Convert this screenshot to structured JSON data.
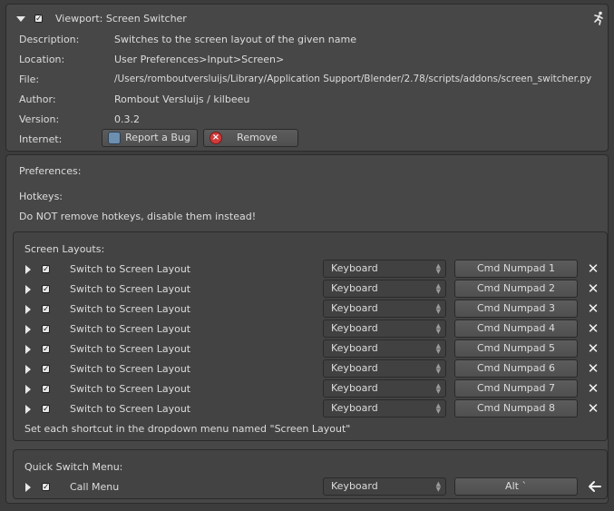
{
  "header": {
    "title": "Viewport: Screen Switcher"
  },
  "info": {
    "description_label": "Description:",
    "description_value": "Switches to the screen layout of the given name",
    "location_label": "Location:",
    "location_value": "User Preferences>Input>Screen>",
    "file_label": "File:",
    "file_value": "/Users/romboutversluijs/Library/Application Support/Blender/2.78/scripts/addons/screen_switcher.py",
    "author_label": "Author:",
    "author_value": "Rombout Versluijs / kilbeeu",
    "version_label": "Version:",
    "version_value": "0.3.2",
    "internet_label": "Internet:",
    "report_bug_label": "Report a Bug",
    "remove_label": "Remove"
  },
  "prefs": {
    "preferences_label": "Preferences:",
    "hotkeys_label": "Hotkeys:",
    "hotkeys_note": "Do NOT remove hotkeys, disable them instead!"
  },
  "screen_layouts": {
    "title": "Screen Layouts:",
    "rows": [
      {
        "name": "Switch to Screen Layout",
        "input": "Keyboard",
        "key": "Cmd Numpad 1"
      },
      {
        "name": "Switch to Screen Layout",
        "input": "Keyboard",
        "key": "Cmd Numpad 2"
      },
      {
        "name": "Switch to Screen Layout",
        "input": "Keyboard",
        "key": "Cmd Numpad 3"
      },
      {
        "name": "Switch to Screen Layout",
        "input": "Keyboard",
        "key": "Cmd Numpad 4"
      },
      {
        "name": "Switch to Screen Layout",
        "input": "Keyboard",
        "key": "Cmd Numpad 5"
      },
      {
        "name": "Switch to Screen Layout",
        "input": "Keyboard",
        "key": "Cmd Numpad 6"
      },
      {
        "name": "Switch to Screen Layout",
        "input": "Keyboard",
        "key": "Cmd Numpad 7"
      },
      {
        "name": "Switch to Screen Layout",
        "input": "Keyboard",
        "key": "Cmd Numpad 8"
      }
    ],
    "footer_note": "Set each shortcut in the dropdown menu named \"Screen Layout\""
  },
  "quick_switch": {
    "title": "Quick Switch Menu:",
    "name": "Call Menu",
    "input": "Keyboard",
    "key": "Alt `"
  },
  "colors": {
    "background": "#3c3c3c",
    "panel": "#474747",
    "remove_icon": "#d13b3b"
  }
}
